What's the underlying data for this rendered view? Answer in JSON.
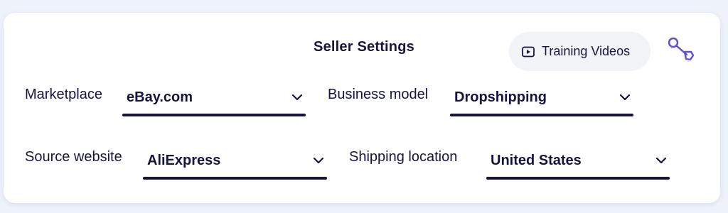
{
  "header": {
    "title": "Seller Settings",
    "training_button_label": "Training Videos"
  },
  "fields": {
    "marketplace": {
      "label": "Marketplace",
      "value": "eBay.com"
    },
    "business_model": {
      "label": "Business model",
      "value": "Dropshipping"
    },
    "source_website": {
      "label": "Source website",
      "value": "AliExpress"
    },
    "shipping_location": {
      "label": "Shipping location",
      "value": "United States"
    }
  },
  "icons": {
    "training": "play-video-icon",
    "settings": "wrench-icon",
    "dropdown": "chevron-down-icon"
  },
  "colors": {
    "text": "#161540",
    "accent": "#5b4fe0",
    "button_bg": "#f1f3f6",
    "page_bg": "#eef3fb"
  }
}
